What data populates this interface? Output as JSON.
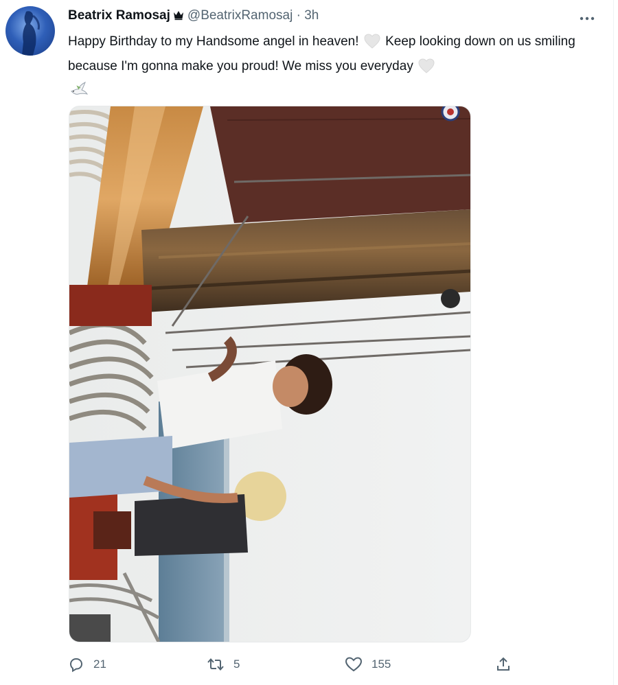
{
  "tweet": {
    "author": {
      "name": "Beatrix Ramosaj",
      "handle": "@BeatrixRamosaj",
      "separator": "·",
      "time": "3h"
    },
    "text": {
      "part1": "Happy Birthday to my Handsome angel in heaven!",
      "part2": "Keep looking down on us smiling because I'm gonna make you proud! We miss you everyday",
      "emojis": [
        "white-heart-emoji",
        "white-heart-emoji",
        "dove-emoji"
      ]
    },
    "media": {
      "type": "photo"
    },
    "actions": {
      "reply": {
        "icon": "reply-icon",
        "count": "21"
      },
      "retweet": {
        "icon": "retweet-icon",
        "count": "5"
      },
      "like": {
        "icon": "heart-icon",
        "count": "155"
      },
      "share": {
        "icon": "share-icon"
      }
    }
  },
  "colors": {
    "text": "#0f1419",
    "secondary": "#536471",
    "divider": "#eff3f4"
  }
}
